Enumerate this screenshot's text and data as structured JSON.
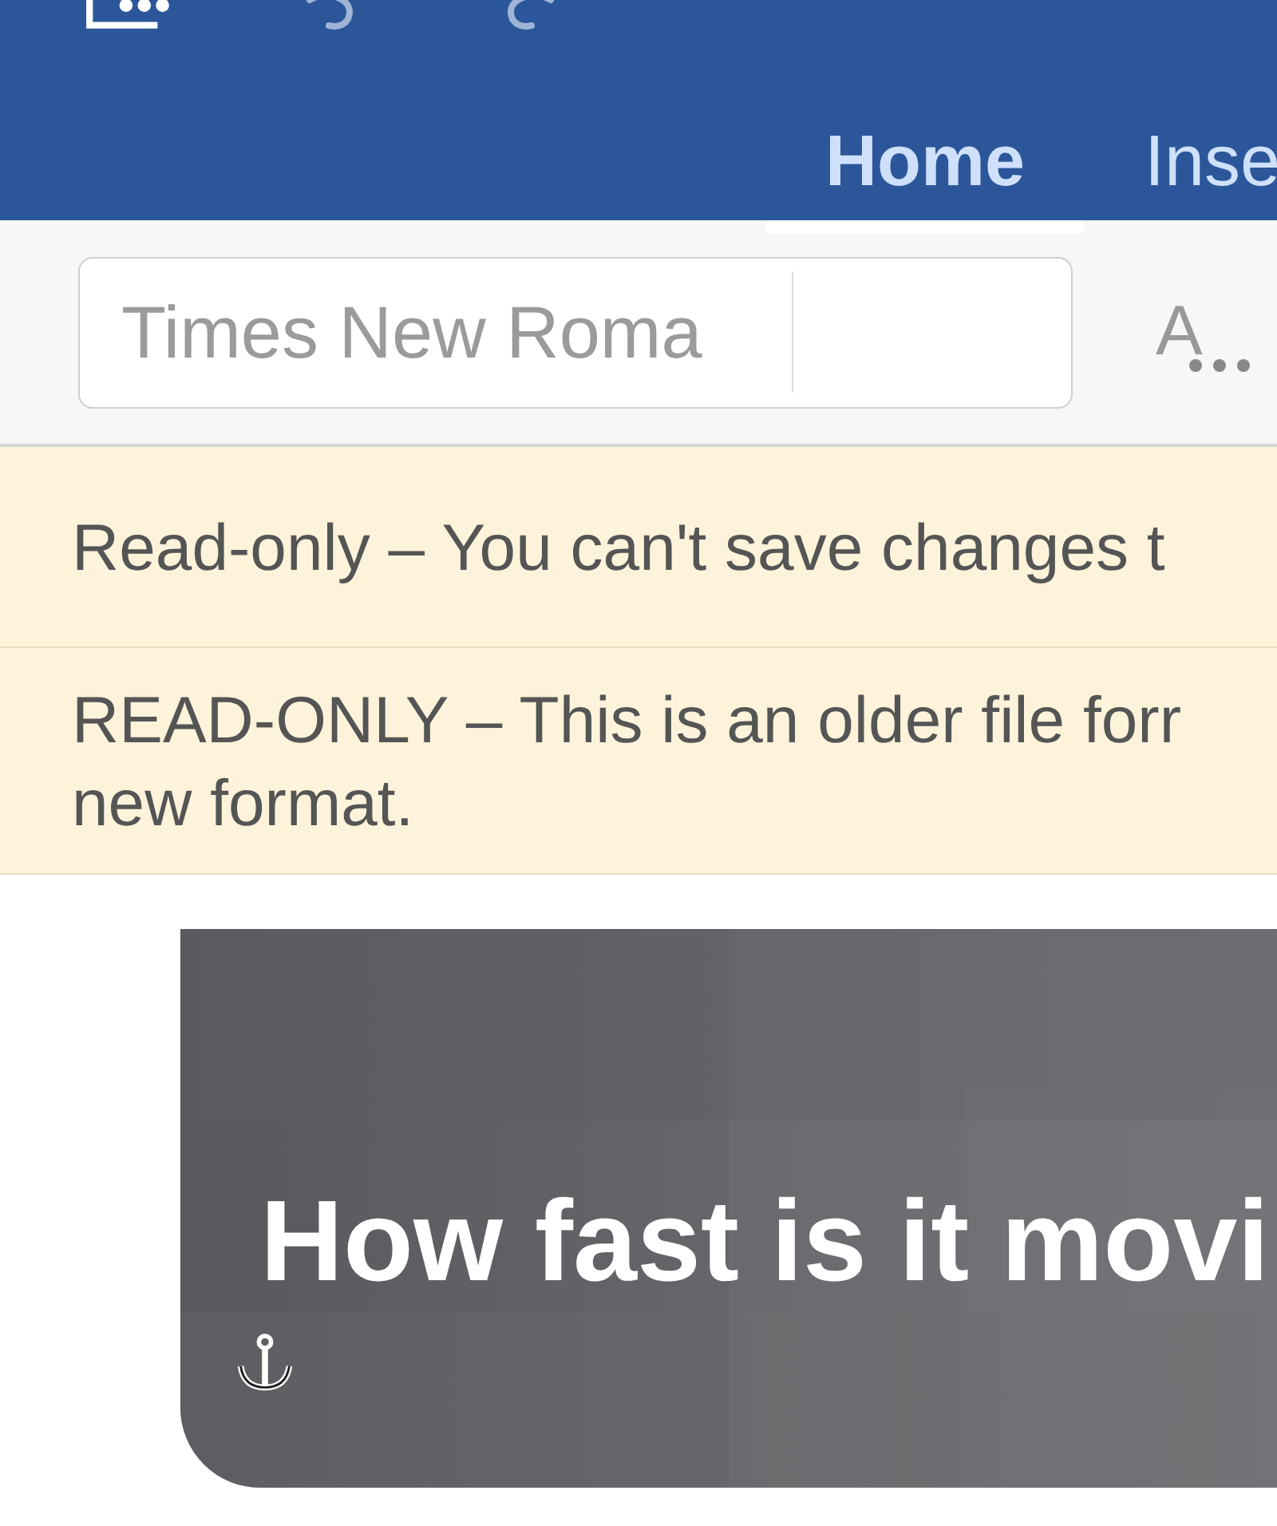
{
  "ribbon": {
    "tabs": [
      {
        "label": "Home",
        "selected": true
      },
      {
        "label": "Inse",
        "selected": false
      }
    ]
  },
  "toolbar": {
    "font_field": {
      "value": "Times New Roma"
    },
    "text_style_button": {
      "label": "A"
    }
  },
  "banners": [
    {
      "text": "Read-only – You can't save changes t"
    },
    {
      "text": "READ-ONLY – This is an older file forr\nnew format."
    }
  ],
  "document": {
    "image": {
      "heading": "How fast is it movi"
    }
  }
}
